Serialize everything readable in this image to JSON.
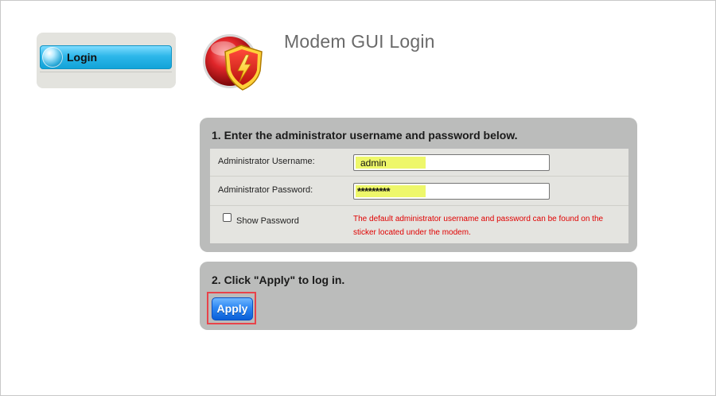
{
  "sidebar": {
    "items": [
      {
        "label": "Login",
        "active": true
      }
    ]
  },
  "header": {
    "title": "Modem GUI Login",
    "logo_icon": "shield-lightning-icon"
  },
  "step1": {
    "heading": "1. Enter the administrator username and password below.",
    "username_label": "Administrator Username:",
    "username_value": "admin",
    "password_label": "Administrator Password:",
    "password_value": "*********",
    "show_password_label": "Show Password",
    "show_password_checked": false,
    "note": "The default administrator username and password can be found on the sticker located under the modem."
  },
  "step2": {
    "heading": "2. Click \"Apply\" to log in.",
    "apply_label": "Apply"
  },
  "colors": {
    "panel_bg": "#bbbcbb",
    "form_bg": "#e4e4e0",
    "note_text": "#e00000",
    "apply_button": "#2c86f2",
    "highlight_border": "#e8434a",
    "field_highlight": "#eef76a"
  }
}
